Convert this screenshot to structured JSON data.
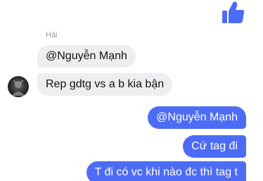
{
  "thread": {
    "like_icon": "thumbs-up-icon",
    "accent_color": "#4d6cf6",
    "incoming_bubble_color": "#eeeef0",
    "incoming": {
      "sender_name": "Hải",
      "avatar_icon": "user-avatar",
      "messages": [
        "@Nguyễn Mạnh",
        "Rep gdtg vs a b kia bận"
      ]
    },
    "outgoing": {
      "messages": [
        "@Nguyễn Mạnh",
        "Cứ tag đi",
        "T đi có vc khi nào đc thì tag t"
      ]
    }
  }
}
